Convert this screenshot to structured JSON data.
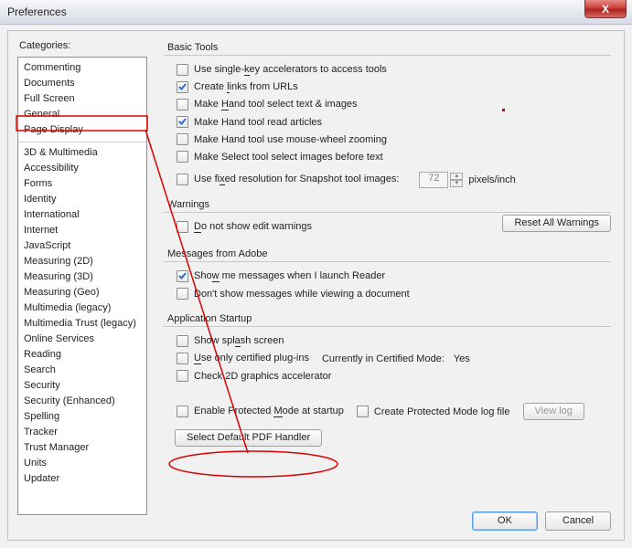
{
  "window": {
    "title": "Preferences",
    "close": "X"
  },
  "sidebar": {
    "label": "Categories:",
    "groups": [
      {
        "items": [
          "Commenting",
          "Documents",
          "Full Screen",
          "General",
          "Page Display"
        ]
      },
      {
        "items": [
          "3D & Multimedia",
          "Accessibility",
          "Forms",
          "Identity",
          "International",
          "Internet",
          "JavaScript",
          "Measuring (2D)",
          "Measuring (3D)",
          "Measuring (Geo)",
          "Multimedia (legacy)",
          "Multimedia Trust (legacy)",
          "Online Services",
          "Reading",
          "Search",
          "Security",
          "Security (Enhanced)",
          "Spelling",
          "Tracker",
          "Trust Manager",
          "Units",
          "Updater"
        ]
      }
    ]
  },
  "basic": {
    "title": "Basic Tools",
    "r1": {
      "pre": "Use single-",
      "u": "k",
      "post": "ey accelerators to access tools"
    },
    "r2": {
      "pre": "Create ",
      "u": "l",
      "post": "inks from URLs"
    },
    "r3": {
      "pre": "Make ",
      "u": "H",
      "post": "and tool select text & images"
    },
    "r4": "Make Hand tool read articles",
    "r5": "Make Hand tool use mouse-wheel zooming",
    "r6": "Make Select tool select images before text",
    "r7": {
      "pre": "Use fi",
      "u": "x",
      "post": "ed resolution for Snapshot tool images:"
    },
    "r7val": "72",
    "r7unit": "pixels/inch"
  },
  "warn": {
    "title": "Warnings",
    "r1": {
      "u": "D",
      "post": "o not show edit warnings"
    },
    "reset": "Reset All Warnings"
  },
  "msg": {
    "title": "Messages from Adobe",
    "r1": {
      "pre": "Sho",
      "u": "w",
      "post": " me messages when I launch Reader"
    },
    "r2": "Don't show messages while viewing a document"
  },
  "app": {
    "title": "Application Startup",
    "r1": {
      "pre": "Show spl",
      "u": "a",
      "post": "sh screen"
    },
    "r2": {
      "u": "U",
      "post": "se only certified plug-ins"
    },
    "cert_lbl": "Currently in Certified Mode:",
    "cert_val": "Yes",
    "r3": "Check 2D graphics accelerator",
    "r4": {
      "pre": "Enable Protected ",
      "u": "M",
      "post": "ode at startup"
    },
    "r5": "Create Protected Mode log file",
    "viewlog": "View log",
    "select": "Select Default PDF Handler"
  },
  "footer": {
    "ok": "OK",
    "cancel": "Cancel"
  },
  "annotation": {
    "dot": "#c00"
  }
}
